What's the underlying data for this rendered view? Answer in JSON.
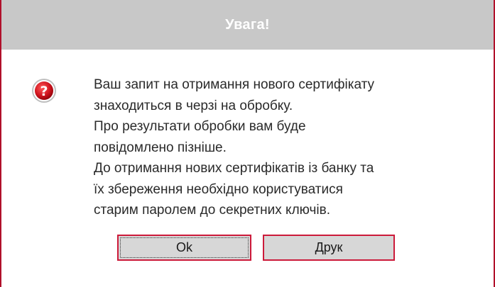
{
  "dialog": {
    "title": "Увага!",
    "icon": "question-icon",
    "message_lines": [
      "Ваш запит на отримання нового сертифікату",
      "знаходиться в черзі на обробку.",
      "Про результати обробки вам буде",
      "повідомлено пізніше.",
      "До отримання нових сертифікатів із банку та",
      "їх збереження необхідно користуватися",
      "старим паролем до секретних ключів."
    ],
    "buttons": {
      "ok_label": "Ok",
      "print_label": "Друк"
    }
  },
  "colors": {
    "accent": "#cc1a3a",
    "titlebar_bg": "#c8c8c8",
    "button_bg": "#d7d7d7"
  }
}
